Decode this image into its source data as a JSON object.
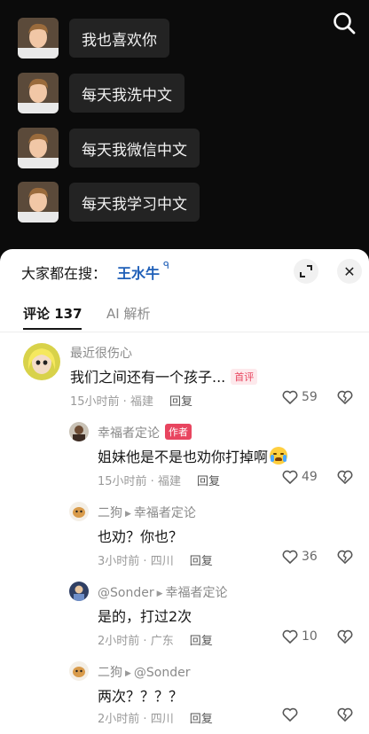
{
  "chat": {
    "messages": [
      {
        "text": "我也喜欢你"
      },
      {
        "text": "每天我洗中文"
      },
      {
        "text": "每天我微信中文"
      },
      {
        "text": "每天我学习中文"
      }
    ]
  },
  "icons": {
    "search": "search-icon",
    "expand": "expand-icon",
    "close": "close-icon",
    "heart": "heart-icon",
    "broken_heart": "broken-heart-icon"
  },
  "search_bar": {
    "prefix": "大家都在搜：",
    "term": "王水牛",
    "term_icon": "ᑫ",
    "close_glyph": "✕"
  },
  "tabs": {
    "comments_label": "评论 137",
    "ai_label": "AI 解析"
  },
  "comments": [
    {
      "user": "最近很伤心",
      "text": "我们之间还有一个孩子...",
      "badge": "首评",
      "time": "15小时前",
      "location": "福建",
      "reply_label": "回复",
      "likes": "59"
    },
    {
      "user": "幸福者定论",
      "badge": "作者",
      "text": "姐妹他是不是也劝你打掉啊",
      "time": "15小时前",
      "location": "福建",
      "reply_label": "回复",
      "likes": "49"
    },
    {
      "user": "二狗",
      "reply_to": "幸福者定论",
      "text": "也劝？你也？",
      "time": "3小时前",
      "location": "四川",
      "reply_label": "回复",
      "likes": "36"
    },
    {
      "user": "@Sonder",
      "reply_to": "幸福者定论",
      "text": "是的，打过2次",
      "time": "2小时前",
      "location": "广东",
      "reply_label": "回复",
      "likes": "10"
    },
    {
      "user": "二狗",
      "reply_to": "@Sonder",
      "text": "两次？？？？",
      "time": "2小时前",
      "location": "四川",
      "reply_label": "回复",
      "likes": ""
    }
  ],
  "separators": {
    "dot": " · ",
    "reply_arrow": "▶"
  },
  "colors": {
    "accent_blue": "#1f5fb8",
    "badge_red": "#e8455f",
    "dark_bg": "#0b0b0b",
    "bubble": "#232323"
  }
}
